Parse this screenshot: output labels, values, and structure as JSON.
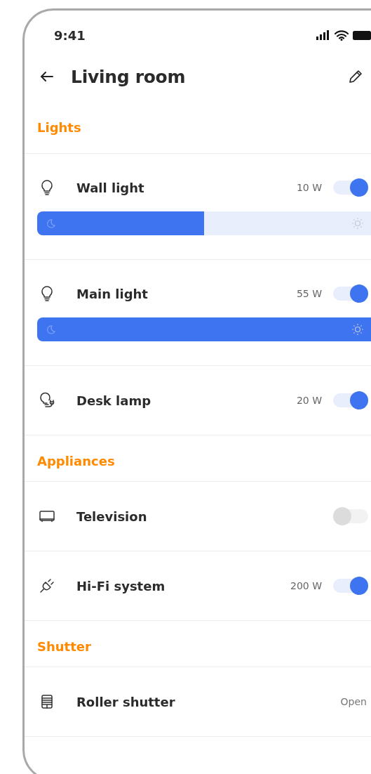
{
  "status_bar": {
    "time": "9:41"
  },
  "header": {
    "title": "Living room"
  },
  "sections": [
    {
      "title": "Lights",
      "items": [
        {
          "kind": "dimmer",
          "name": "Wall light",
          "power": "10 W",
          "on": true,
          "level": 0.5
        },
        {
          "kind": "dimmer",
          "name": "Main light",
          "power": "55 W",
          "on": true,
          "level": 1.0
        },
        {
          "kind": "switch",
          "name": "Desk lamp",
          "power": "20 W",
          "on": true
        }
      ]
    },
    {
      "title": "Appliances",
      "items": [
        {
          "kind": "switch",
          "name": "Television",
          "on": false
        },
        {
          "kind": "switch",
          "name": "Hi-Fi system",
          "power": "200 W",
          "on": true
        }
      ]
    },
    {
      "title": "Shutter",
      "items": [
        {
          "kind": "status",
          "name": "Roller shutter",
          "status": "Open"
        }
      ]
    }
  ]
}
